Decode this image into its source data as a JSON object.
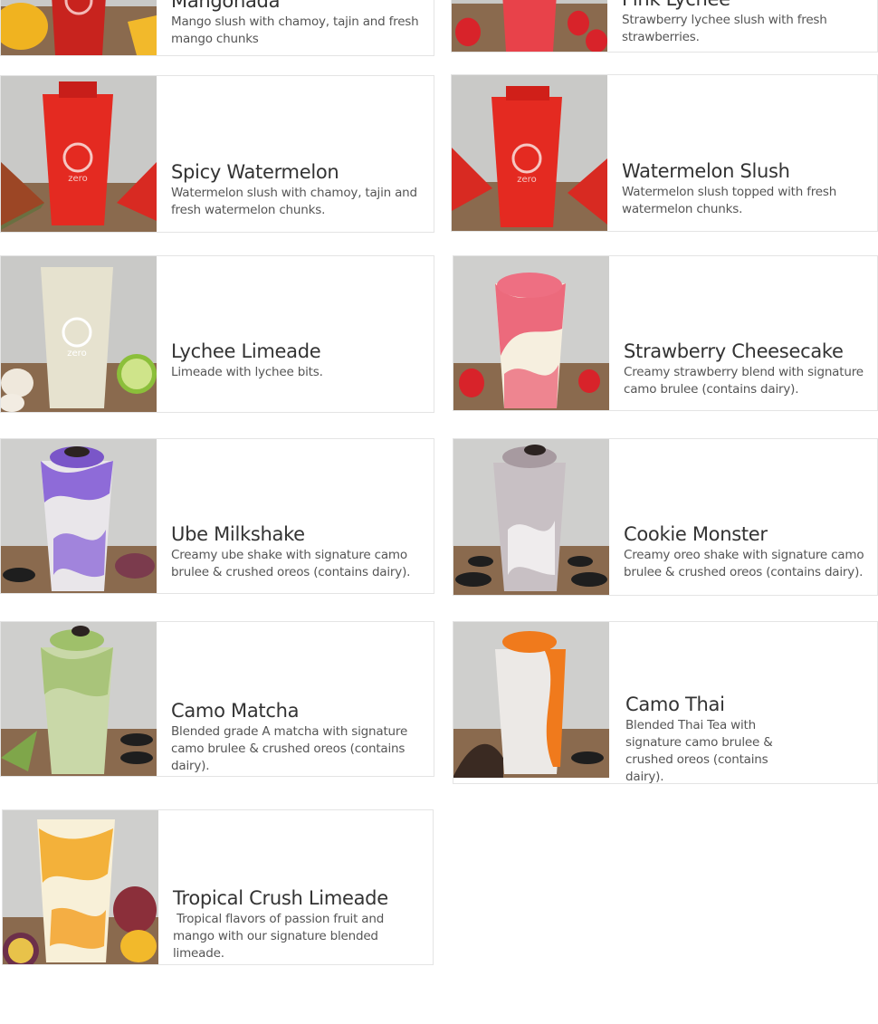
{
  "menu": {
    "items": [
      {
        "title": "Mangonada",
        "description": "Mango slush with chamoy, tajin and fresh mango chunks"
      },
      {
        "title": "Pink Lychee",
        "description": "Strawberry lychee slush with fresh strawberries."
      },
      {
        "title": "Spicy Watermelon",
        "description": "Watermelon slush with chamoy, tajin and fresh watermelon chunks."
      },
      {
        "title": "Watermelon Slush",
        "description": "Watermelon slush topped with fresh watermelon chunks."
      },
      {
        "title": "Lychee Limeade",
        "description": "Limeade with lychee bits."
      },
      {
        "title": "Strawberry Cheesecake",
        "description": "Creamy strawberry blend with signature camo brulee (contains dairy)."
      },
      {
        "title": "Ube Milkshake",
        "description": "Creamy ube shake with signature camo brulee & crushed oreos (contains dairy)."
      },
      {
        "title": "Cookie Monster",
        "description": "Creamy oreo shake with signature camo brulee & crushed oreos (contains dairy)."
      },
      {
        "title": "Camo Matcha",
        "description": "Blended grade A matcha with signature camo brulee & crushed oreos (contains dairy)."
      },
      {
        "title": "Camo Thai",
        "description": "Blended Thai Tea with signature camo brulee & crushed oreos (contains dairy)."
      },
      {
        "title": "Tropical Crush Limeade",
        "description": " Tropical flavors of passion fruit and mango with our signature blended limeade."
      }
    ],
    "cup_logo": "zero",
    "colors": {
      "mangonada": "#c8231e",
      "pink_lychee": "#e8424a",
      "watermelon": "#e02a20",
      "lychee_limeade": "#e6e2cf",
      "strawberry_cheesecake": "#ec6a7c",
      "ube": "#8e6bd8",
      "cookie_monster": "#a79aa0",
      "matcha": "#a9c47a",
      "thai": "#f07a1c",
      "tropical": "#f3b13a"
    }
  }
}
